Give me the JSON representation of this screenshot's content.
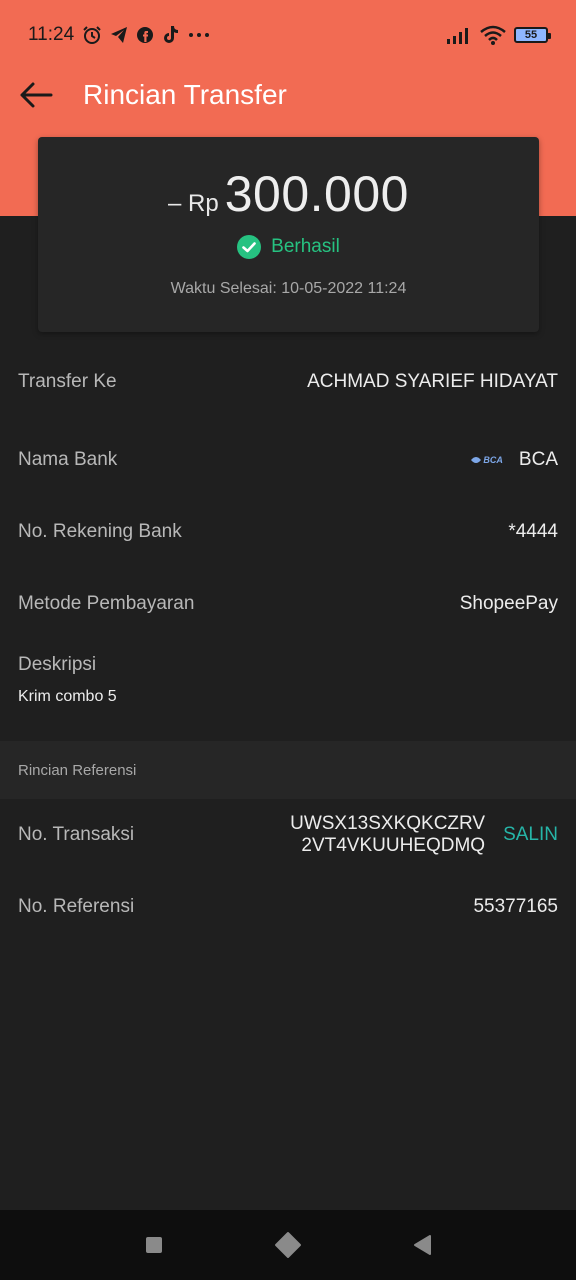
{
  "status_bar": {
    "time": "11:24",
    "battery": "55",
    "icons": [
      "alarm-icon",
      "telegram-icon",
      "facebook-icon",
      "tiktok-icon",
      "more-dots-icon",
      "signal-icon",
      "wifi-icon",
      "battery-icon"
    ]
  },
  "header": {
    "title": "Rincian Transfer",
    "back_icon": "arrow-left-icon"
  },
  "amount_card": {
    "prefix": "– Rp",
    "amount": "300.000",
    "status": "Berhasil",
    "completed_time": "Waktu Selesai: 10-05-2022 11:24"
  },
  "details": {
    "transfer_to_label": "Transfer Ke",
    "transfer_to_value": "ACHMAD SYARIEF HIDAYAT",
    "bank_name_label": "Nama Bank",
    "bank_logo": "BCA",
    "bank_name_value": "BCA",
    "account_label": "No. Rekening Bank",
    "account_value": "*4444",
    "method_label": "Metode Pembayaran",
    "method_value": "ShopeePay",
    "description_label": "Deskripsi",
    "description_value": "Krim combo 5"
  },
  "reference": {
    "section_title": "Rincian Referensi",
    "transaction_label": "No. Transaksi",
    "transaction_line1": "UWSX13SXKQKCZRV",
    "transaction_line2": "2VT4VKUUHEQDMQ",
    "copy_label": "SALIN",
    "reference_label": "No. Referensi",
    "reference_value": "55377165"
  },
  "colors": {
    "header": "#f26b53",
    "background": "#1f1f1f",
    "success": "#26c281",
    "copy": "#26b5a8"
  }
}
